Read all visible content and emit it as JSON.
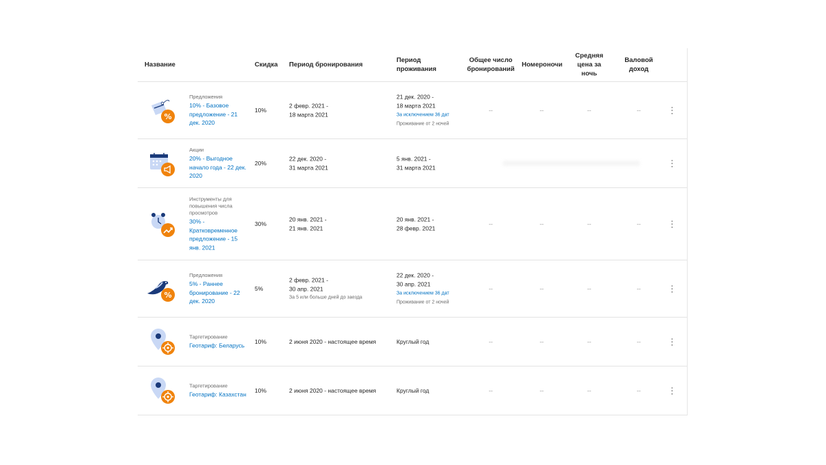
{
  "headers": {
    "name": "Название",
    "discount": "Скидка",
    "booking_period": "Период бронирования",
    "stay_period_line1": "Период",
    "stay_period_line2": "проживания",
    "total_bookings_line1": "Общее число",
    "total_bookings_line2": "бронирований",
    "room_nights": "Номероночи",
    "avg_price_line1": "Средняя",
    "avg_price_line2": "цена за",
    "avg_price_line3": "ночь",
    "gross_revenue_line1": "Валовой",
    "gross_revenue_line2": "доход"
  },
  "rows": [
    {
      "icon": "tag-percent-icon",
      "category": "Предложения",
      "title": "10% - Базовое предложение - 21 дек. 2020",
      "discount": "10%",
      "booking_line1": "2 февр. 2021 -",
      "booking_line2": "18 марта 2021",
      "booking_note": "",
      "stay_line1": "21 дек. 2020 -",
      "stay_line2": "18 марта 2021",
      "stay_exclusion": "За исключением 36 дат",
      "stay_note": "Проживание от 2 ночей",
      "total": "--",
      "nights": "--",
      "avg": "--",
      "revenue": "--"
    },
    {
      "icon": "calendar-megaphone-icon",
      "category": "Акции",
      "title": "20% - Выгодное начало года - 22 дек. 2020",
      "discount": "20%",
      "booking_line1": "22 дек. 2020 -",
      "booking_line2": "31 марта 2021",
      "booking_note": "",
      "stay_line1": "5 янв. 2021 -",
      "stay_line2": "31 марта 2021",
      "stay_exclusion": "",
      "stay_note": "",
      "total": "",
      "nights": "",
      "avg": "",
      "revenue": ""
    },
    {
      "icon": "clock-trend-icon",
      "category": "Инструменты для повышения числа просмотров",
      "title": "30% - Кратковременное предложение - 15 янв. 2021",
      "discount": "30%",
      "booking_line1": "20 янв. 2021 -",
      "booking_line2": "21 янв. 2021",
      "booking_note": "",
      "stay_line1": "20 янв. 2021 -",
      "stay_line2": "28 февр. 2021",
      "stay_exclusion": "",
      "stay_note": "",
      "total": "--",
      "nights": "--",
      "avg": "--",
      "revenue": "--"
    },
    {
      "icon": "bird-percent-icon",
      "category": "Предложения",
      "title": "5% - Раннее бронирование - 22 дек. 2020",
      "discount": "5%",
      "booking_line1": "2 февр. 2021 -",
      "booking_line2": "30 апр. 2021",
      "booking_note": "За 5 или больше дней до заезда",
      "stay_line1": "22 дек. 2020 -",
      "stay_line2": "30 апр. 2021",
      "stay_exclusion": "За исключением 36 дат",
      "stay_note": "Проживание от 2 ночей",
      "total": "--",
      "nights": "--",
      "avg": "--",
      "revenue": "--"
    },
    {
      "icon": "map-pin-target-icon",
      "category": "Таргетирование",
      "title": "Геотариф: Беларусь",
      "discount": "10%",
      "booking_line1": "2 июня 2020 - настоящее время",
      "booking_line2": "",
      "booking_note": "",
      "stay_line1": "Круглый год",
      "stay_line2": "",
      "stay_exclusion": "",
      "stay_note": "",
      "total": "--",
      "nights": "--",
      "avg": "--",
      "revenue": "--"
    },
    {
      "icon": "map-pin-target-icon",
      "category": "Таргетирование",
      "title": "Геотариф: Казахстан",
      "discount": "10%",
      "booking_line1": "2 июня 2020 - настоящее время",
      "booking_line2": "",
      "booking_note": "",
      "stay_line1": "Круглый год",
      "stay_line2": "",
      "stay_exclusion": "",
      "stay_note": "",
      "total": "--",
      "nights": "--",
      "avg": "--",
      "revenue": "--"
    }
  ],
  "kebab_glyph": "⋮",
  "colors": {
    "link": "#0071c2",
    "accent_orange": "#f0830c",
    "icon_blue": "#1a3a7a",
    "icon_light": "#c9d8f5"
  }
}
